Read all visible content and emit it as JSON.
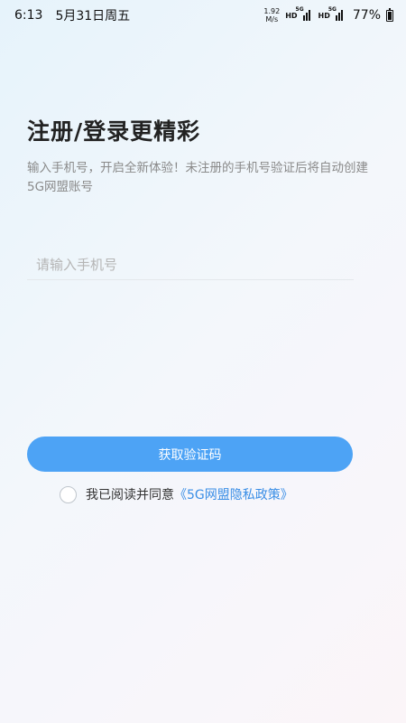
{
  "status_bar": {
    "time": "6:13",
    "date": "5月31日周五",
    "speed_value": "1.92",
    "speed_unit": "M/s",
    "hd_1": "HD",
    "net_1": "5G",
    "hd_2": "HD",
    "net_2": "5G",
    "battery": "77%"
  },
  "login": {
    "title": "注册/登录更精彩",
    "subtitle": "输入手机号，开启全新体验！未注册的手机号验证后将自动创建5G网盟账号",
    "phone_placeholder": "请输入手机号",
    "phone_value": "",
    "submit_label": "获取验证码",
    "agree_label": "我已阅读并同意",
    "policy_link": "《5G网盟隐私政策》"
  },
  "colors": {
    "accent": "#4da3f5",
    "link": "#3a8ee6"
  }
}
